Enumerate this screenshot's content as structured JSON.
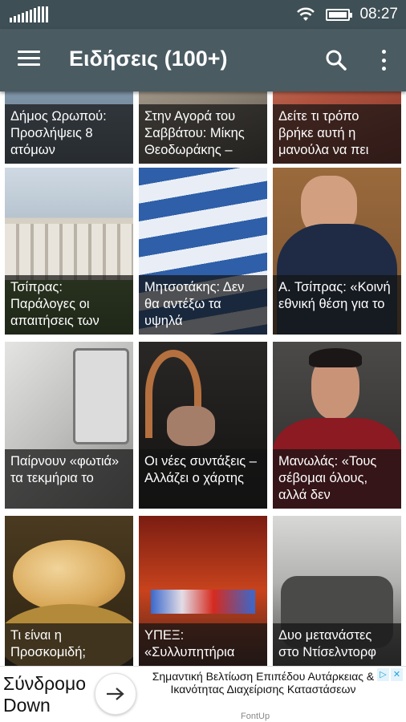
{
  "status_bar": {
    "time": "08:27"
  },
  "app_bar": {
    "title": "Ειδήσεις (100+)"
  },
  "articles": [
    {
      "caption": "Δήμος Ωρωπού: Προσλήψεις 8 ατόμων"
    },
    {
      "caption": "Στην Αγορά του Σαββάτου: Μίκης Θεοδωράκης –"
    },
    {
      "caption": "Δείτε τι τρόπο βρήκε αυτή η μανούλα να πει"
    },
    {
      "caption": "Τσίπρας: Παράλογες οι απαιτήσεις των"
    },
    {
      "caption": "Μητσοτάκης: Δεν θα αντέξω τα υψηλά"
    },
    {
      "caption": "Α. Τσίπρας: «Κοινή εθνική θέση για το"
    },
    {
      "caption": "Παίρνουν «φωτιά» τα τεκμήρια το"
    },
    {
      "caption": "Οι νέες συντάξεις – Αλλάζει ο χάρτης"
    },
    {
      "caption": "Μανωλάς: «Τους σέβομαι όλους, αλλά δεν"
    },
    {
      "caption": "Τι είναι η Προσκομιδή;"
    },
    {
      "caption": "ΥΠΕΞ: «Συλλυπητήρια"
    },
    {
      "caption": "Δυο μετανάστες στο Ντίσελντορφ"
    }
  ],
  "ad": {
    "brand_line1": "Σύνδρομο",
    "brand_line2": "Down",
    "headline": "Σημαντική Βελτίωση Επιπέδου Αυτάρκειας & Ικανότητας Διαχείρισης Καταστάσεων",
    "sponsor": "FontUp"
  }
}
